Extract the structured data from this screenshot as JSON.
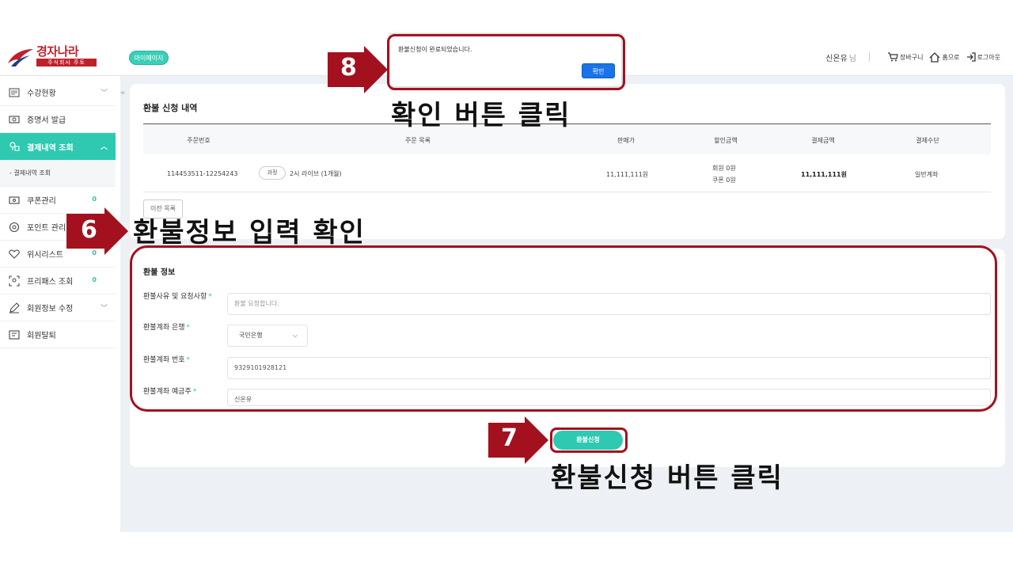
{
  "header": {
    "logo_brand": "경자나라",
    "logo_corp": "주식회사 주토",
    "mypage_label": "마이페이지",
    "user_name": "신온유",
    "user_suffix": "님",
    "cart_label": "장바구니",
    "home_label": "홈으로",
    "logout_label": "로그아웃"
  },
  "sidebar": {
    "items": [
      {
        "label": "수강현황",
        "chevron": "﹀"
      },
      {
        "label": "증명서 발급"
      },
      {
        "label": "결제내역 조회",
        "chevron": "︿"
      },
      {
        "label": "- 결제내역 조회"
      },
      {
        "label": "쿠폰관리",
        "count": "0"
      },
      {
        "label": "포인트 관리"
      },
      {
        "label": "위시리스트",
        "count": "0"
      },
      {
        "label": "프리패스 조회",
        "count": "0"
      },
      {
        "label": "회원정보 수정",
        "chevron": "﹀"
      },
      {
        "label": "회원탈퇴"
      }
    ],
    "collapse_label": "«"
  },
  "order_section": {
    "title": "환불 신청 내역",
    "columns": [
      "주문번호",
      "주문 목록",
      "판매가",
      "할인금액",
      "결제금액",
      "결제수단"
    ],
    "row": {
      "order_no": "114453511-12254243",
      "tag": "과정",
      "item": "2시 라이브 (1개월)",
      "price": "11,111,111원",
      "discount_member": "회원  0원",
      "discount_coupon": "쿠폰  0원",
      "paid": "11,111,111원",
      "method": "일반계좌"
    },
    "prev_button": "이전 목록"
  },
  "refund_form": {
    "title": "환불 정보",
    "reason_label": "환불사유 및 요청사항",
    "reason_value": "환불 요청합니다.",
    "bank_label": "환불계좌 은행",
    "bank_value": "국민은행",
    "account_label": "환불계좌 번호",
    "account_value": "9329101928121",
    "holder_label": "환불계좌 예금주",
    "holder_value": "신온유",
    "required_mark": "*",
    "submit_label": "환불신청"
  },
  "dialog": {
    "message": "환불신청이 완료되었습니다.",
    "ok_label": "확인"
  },
  "annotations": {
    "step6_number": "6",
    "step6_text": "환불정보 입력 확인",
    "step7_number": "7",
    "step7_text": "환불신청 버튼 클릭",
    "step8_number": "8",
    "step8_text": "확인 버튼 클릭",
    "accent_color": "#a3111f"
  },
  "colors": {
    "teal": "#2ec9b0",
    "brand_red": "#c0202a",
    "dialog_blue": "#1a73e8"
  }
}
